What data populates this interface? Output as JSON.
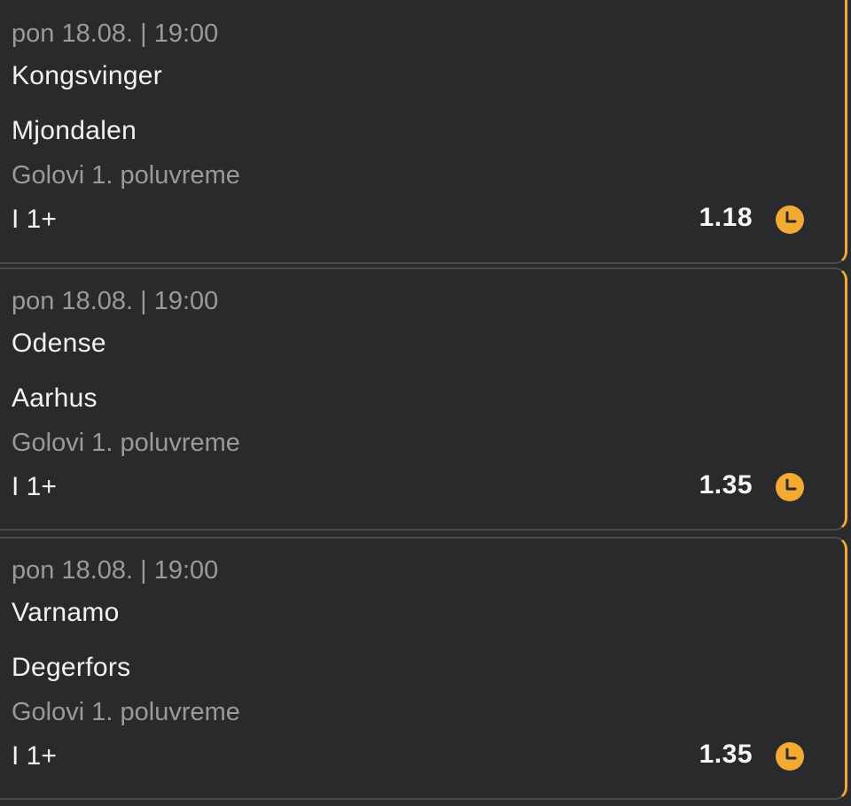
{
  "tickets": [
    {
      "date": "pon 18.08. | 19:00",
      "team_home": "Kongsvinger",
      "team_away": "Mjondalen",
      "market": "Golovi 1. poluvreme",
      "pick": "I 1+",
      "odds": "1.18",
      "status_icon": "clock-icon",
      "status_color": "#f2aa33"
    },
    {
      "date": "pon 18.08. | 19:00",
      "team_home": "Odense",
      "team_away": "Aarhus",
      "market": "Golovi 1. poluvreme",
      "pick": "I 1+",
      "odds": "1.35",
      "status_icon": "clock-icon",
      "status_color": "#f2aa33"
    },
    {
      "date": "pon 18.08. | 19:00",
      "team_home": "Varnamo",
      "team_away": "Degerfors",
      "market": "Golovi 1. poluvreme",
      "pick": "I 1+",
      "odds": "1.35",
      "status_icon": "clock-icon",
      "status_color": "#f2aa33"
    }
  ]
}
